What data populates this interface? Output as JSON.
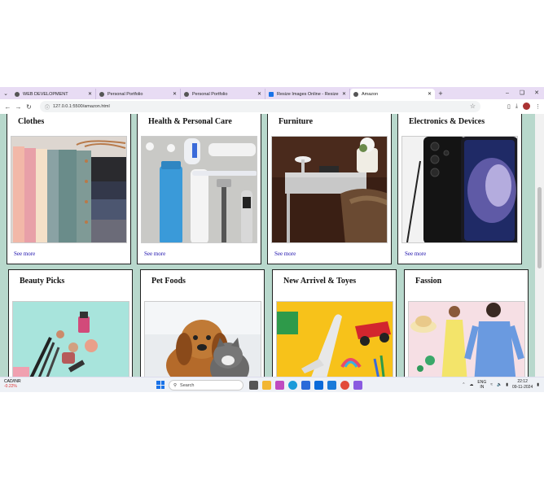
{
  "browser": {
    "tabs": [
      {
        "title": "WEB DEVELOPMENT",
        "icon": "globe-icon",
        "active": false
      },
      {
        "title": "Personal Portfolio",
        "icon": "globe-icon",
        "active": false
      },
      {
        "title": "Personal Portfolio",
        "icon": "globe-icon",
        "active": false
      },
      {
        "title": "Resize Images Online - Resize",
        "icon": "resize-site-icon",
        "active": false
      },
      {
        "title": "Amazon",
        "icon": "globe-icon",
        "active": true
      }
    ],
    "url": "127.0.0.1:5500/amazon.html"
  },
  "cards_row1": [
    {
      "title": "Clothes",
      "link": "See more",
      "image": "folded-clothes-on-hangers"
    },
    {
      "title": "Health & Personal Care",
      "link": "See more",
      "image": "personal-care-products"
    },
    {
      "title": "Furniture",
      "link": "See more",
      "image": "desk-and-chair"
    },
    {
      "title": "Electronics & Devices",
      "link": "See more",
      "image": "smartphone"
    }
  ],
  "cards_row2": [
    {
      "title": "Beauty Picks",
      "image": "makeup-products"
    },
    {
      "title": "Pet Foods",
      "image": "dog-and-cat"
    },
    {
      "title": "New Arrivel & Toyes",
      "image": "toys-on-yellow"
    },
    {
      "title": "Fassion",
      "image": "fashion-models"
    }
  ],
  "taskbar": {
    "ticker_symbol": "CAD/INR",
    "ticker_change": "-0.22%",
    "search_placeholder": "Search",
    "lang_top": "ENG",
    "lang_bottom": "IN",
    "time": "22:12",
    "date": "09-11-2024"
  },
  "colors": {
    "page_background": "#b8d8cc",
    "tab_strip": "#e8dcf4",
    "link": "#1a0dab"
  }
}
